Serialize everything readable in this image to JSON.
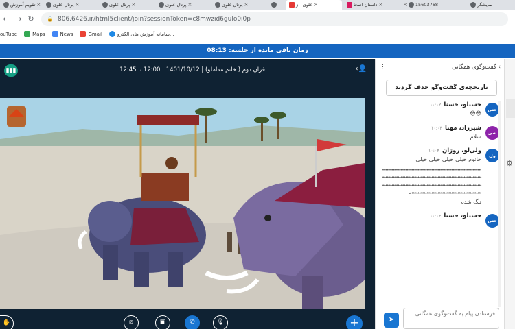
{
  "browser": {
    "tabs": [
      {
        "label": "تقویم آموزش"
      },
      {
        "label": "پرتال علوی"
      },
      {
        "label": "پرتال علوی"
      },
      {
        "label": "پرتال علوی"
      },
      {
        "label": "پرتال علوی"
      },
      {
        "label": "پرتال علوی"
      },
      {
        "label": "علوی - ز"
      },
      {
        "label": "داستان اصحا"
      },
      {
        "label": "15603768"
      },
      {
        "label": "نمایشگر"
      }
    ],
    "url": "806.6426.ir/html5client/join?sessionToken=c8mwzid6gulo0i0p",
    "bookmarks": [
      {
        "label": "ouTube"
      },
      {
        "label": "Maps"
      },
      {
        "label": "News"
      },
      {
        "label": "Gmail"
      },
      {
        "label": "سامانه آموزش های الکترو..."
      }
    ]
  },
  "banner": {
    "text": "زمان باقی مانده از جلسه: 08:13"
  },
  "session": {
    "title": "قرآن دوم ( خانم مداملو) | 1401/10/12 | 12:00 تا 12:45"
  },
  "chat": {
    "title": "گفت‌وگوی همگانی",
    "clear_label": "تاریخچه‌ی گفت‌وگو حذف گردید",
    "messages": [
      {
        "avatar": "حس",
        "name": "حسنلو، حسنا",
        "time": "۱۰:۰۲",
        "text": "😳😳",
        "color": "#1565c0"
      },
      {
        "avatar": "شی",
        "name": "شیرزاد، مهنا",
        "time": "۱۰:۰۳",
        "text": "سلام",
        "color": "#8e24aa"
      },
      {
        "avatar": "ول",
        "name": "ولی‌لو، روژان",
        "time": "۱۰:۰۳",
        "text": "خانوم خیلی خیلی خیلی خیلی",
        "long": "ییییییییییییییییییییییییییییییییییییییییییییییییییییییییییییییییییییییییییییییییییییییییییییییییییییییییییییییییییییییییییییییییییییییییییییییییییییییییییییییییییییییییییییییییییییییییییییییییییییییییییییییییییییییییییییییییییییییییییییییییییییییییییییییییییییییییییییییییییییییییییییییییییییییییی",
        "tail": "تنگ شده",
        "color": "#1565c0"
      },
      {
        "avatar": "حس",
        "name": "حسنلو، حسنا",
        "time": "۱۰:۰۴",
        "text": "",
        "color": "#1565c0"
      }
    ],
    "input_placeholder": "فرستادن پیام به گفت‌وگوی همگانی"
  }
}
